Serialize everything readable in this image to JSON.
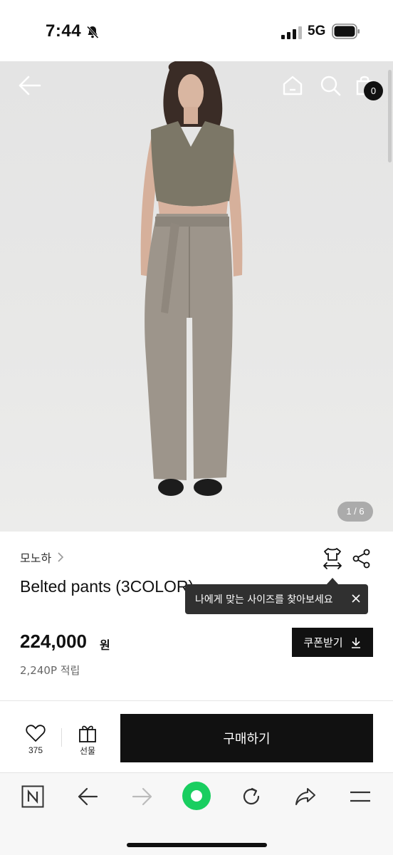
{
  "status_bar": {
    "time": "7:44",
    "network": "5G"
  },
  "hero": {
    "image_counter": "1 / 6",
    "cart_count": "0"
  },
  "product": {
    "brand": "모노하",
    "title": "Belted pants (3COLOR)",
    "price": "224,000",
    "price_unit": "원",
    "points": "2,240P 적립"
  },
  "tooltip": {
    "text": "나에게 맞는 사이즈를 찾아보세요"
  },
  "coupon": {
    "label": "쿠폰받기"
  },
  "action_bar": {
    "like_count": "375",
    "gift_label": "선물",
    "buy_label": "구매하기"
  },
  "colors": {
    "accent": "#111111",
    "tooltip_bg": "#303030",
    "browser_green": "#19ce60"
  }
}
